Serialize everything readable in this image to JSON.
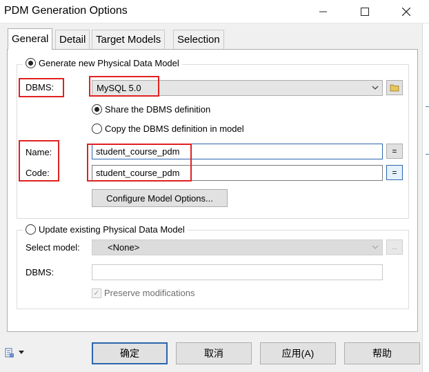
{
  "window": {
    "title": "PDM Generation Options"
  },
  "tabs": [
    {
      "label": "General"
    },
    {
      "label": "Detail"
    },
    {
      "label": "Target Models"
    },
    {
      "label": "Selection"
    }
  ],
  "generate": {
    "radio_label": "Generate new Physical Data Model",
    "dbms_label": "DBMS:",
    "dbms_value": "MySQL 5.0",
    "share_label": "Share the DBMS definition",
    "copy_label": "Copy the DBMS definition in model",
    "name_label": "Name:",
    "name_value": "student_course_pdm",
    "code_label": "Code:",
    "code_value": "student_course_pdm",
    "equals_glyph": "=",
    "configure_label": "Configure Model Options..."
  },
  "update": {
    "radio_label": "Update existing Physical Data Model",
    "select_model_label": "Select model:",
    "select_model_value": "<None>",
    "dbms_label": "DBMS:",
    "dbms_value": "",
    "browse_glyph": "...",
    "preserve_label": "Preserve modifications"
  },
  "buttons": {
    "ok": "确定",
    "cancel": "取消",
    "apply": "应用(A)",
    "help": "帮助"
  },
  "colors": {
    "highlight_box": "#e02020",
    "default_button_border": "#2a64ad"
  }
}
